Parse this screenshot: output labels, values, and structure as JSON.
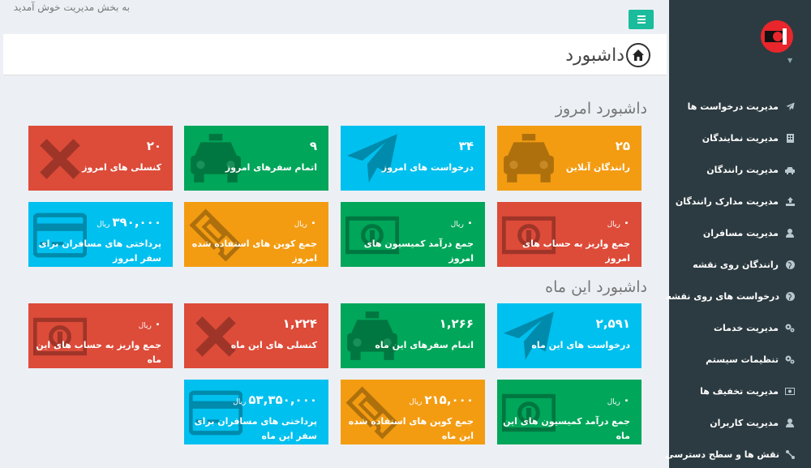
{
  "top": {
    "welcome": "به بخش مدیریت خوش آمدید",
    "page_title": "داشبورد"
  },
  "sections": {
    "today": "داشبورد امروز",
    "month": "داشبورد این ماه"
  },
  "currency": "ریال",
  "tiles": {
    "today_drivers_online": {
      "value": "۲۵",
      "label": "رانندگان آنلاین",
      "color": "#f39c12",
      "icon": "taxi-icon"
    },
    "today_requests": {
      "value": "۳۴",
      "label": "درخواست های امروز",
      "color": "#00c0ef",
      "icon": "paper-plane-icon"
    },
    "today_trips_done": {
      "value": "۹",
      "label": "اتمام سفرهای امروز",
      "color": "#00a65a",
      "icon": "taxi-icon"
    },
    "today_cancels": {
      "value": "۲۰",
      "label": "کنسلی های امروز",
      "color": "#dd4b39",
      "icon": "x-icon"
    },
    "today_deposits": {
      "value": "۰",
      "label": "جمع واریز به حساب های امروز",
      "color": "#dd4b39",
      "icon": "money-icon"
    },
    "today_commission": {
      "value": "۰",
      "label": "جمع درآمد کمیسیون های امروز",
      "color": "#00a65a",
      "icon": "money-icon"
    },
    "today_coupons": {
      "value": "۰",
      "label": "جمع کوپن های استفاده شده امروز",
      "color": "#f39c12",
      "icon": "ticket-icon"
    },
    "today_payments": {
      "value": "۳۹۰,۰۰۰",
      "label": "پرداختی های مسافران برای سفر امروز",
      "color": "#00c0ef",
      "icon": "credit-card-icon"
    },
    "month_requests": {
      "value": "۲,۵۹۱",
      "label": "درخواست های این ماه",
      "color": "#00c0ef",
      "icon": "paper-plane-icon"
    },
    "month_trips_done": {
      "value": "۱,۲۶۶",
      "label": "اتمام سفرهای این ماه",
      "color": "#00a65a",
      "icon": "taxi-icon"
    },
    "month_cancels": {
      "value": "۱,۲۲۴",
      "label": "کنسلی های این ماه",
      "color": "#dd4b39",
      "icon": "x-icon"
    },
    "month_deposits": {
      "value": "۰",
      "label": "جمع واریز به حساب های این ماه",
      "color": "#dd4b39",
      "icon": "money-icon"
    },
    "month_commission": {
      "value": "۰",
      "label": "جمع درآمد کمیسیون های این ماه",
      "color": "#00a65a",
      "icon": "money-icon"
    },
    "month_coupons": {
      "value": "۲۱۵,۰۰۰",
      "label": "جمع کوپن های استفاده شده این ماه",
      "color": "#f39c12",
      "icon": "ticket-icon"
    },
    "month_payments": {
      "value": "۵۳,۳۵۰,۰۰۰",
      "label": "پرداختی های مسافران برای سفر این ماه",
      "color": "#00c0ef",
      "icon": "credit-card-icon"
    }
  },
  "sidebar": {
    "items": [
      {
        "label": "مدیریت درخواست ها",
        "icon": "paper-plane-icon"
      },
      {
        "label": "مدیریت نمایندگان",
        "icon": "building-icon"
      },
      {
        "label": "مدیریت رانندگان",
        "icon": "car-icon"
      },
      {
        "label": "مدیریت مدارک رانندگان",
        "icon": "upload-icon"
      },
      {
        "label": "مدیریت مسافران",
        "icon": "user-icon"
      },
      {
        "label": "رانندگان روی نقشه",
        "icon": "globe-icon"
      },
      {
        "label": "درخواست های روی نقشه",
        "icon": "globe-icon"
      },
      {
        "label": "مدیریت خدمات",
        "icon": "gears-icon"
      },
      {
        "label": "تنظیمات سیستم",
        "icon": "gears-icon"
      },
      {
        "label": "مدیریت تخفیف ها",
        "icon": "money-icon"
      },
      {
        "label": "مدیریت کاربران",
        "icon": "user-icon"
      },
      {
        "label": "نقش ها و سطح دسترسی",
        "icon": "connection-icon"
      }
    ]
  }
}
